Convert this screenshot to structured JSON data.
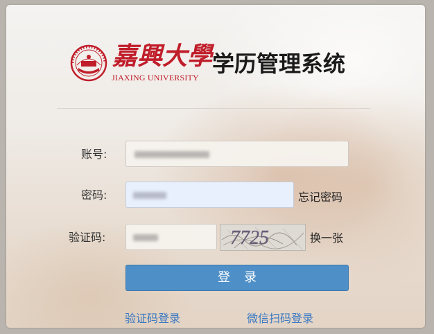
{
  "header": {
    "school_name_cn": "嘉興大學",
    "school_name_en": "JIAXING UNIVERSITY",
    "system_title": "学历管理系统",
    "brand_color": "#c01d2a"
  },
  "form": {
    "account_label": "账号:",
    "password_label": "密码:",
    "captcha_label": "验证码:",
    "forgot_password": "忘记密码",
    "refresh_captcha": "换一张",
    "captcha_image_text": "7725",
    "login_button": "登录"
  },
  "links": {
    "sms_login": "验证码登录",
    "wechat_login": "微信扫码登录"
  },
  "colors": {
    "button_bg": "#4f8fc7",
    "link": "#3a78c2"
  }
}
